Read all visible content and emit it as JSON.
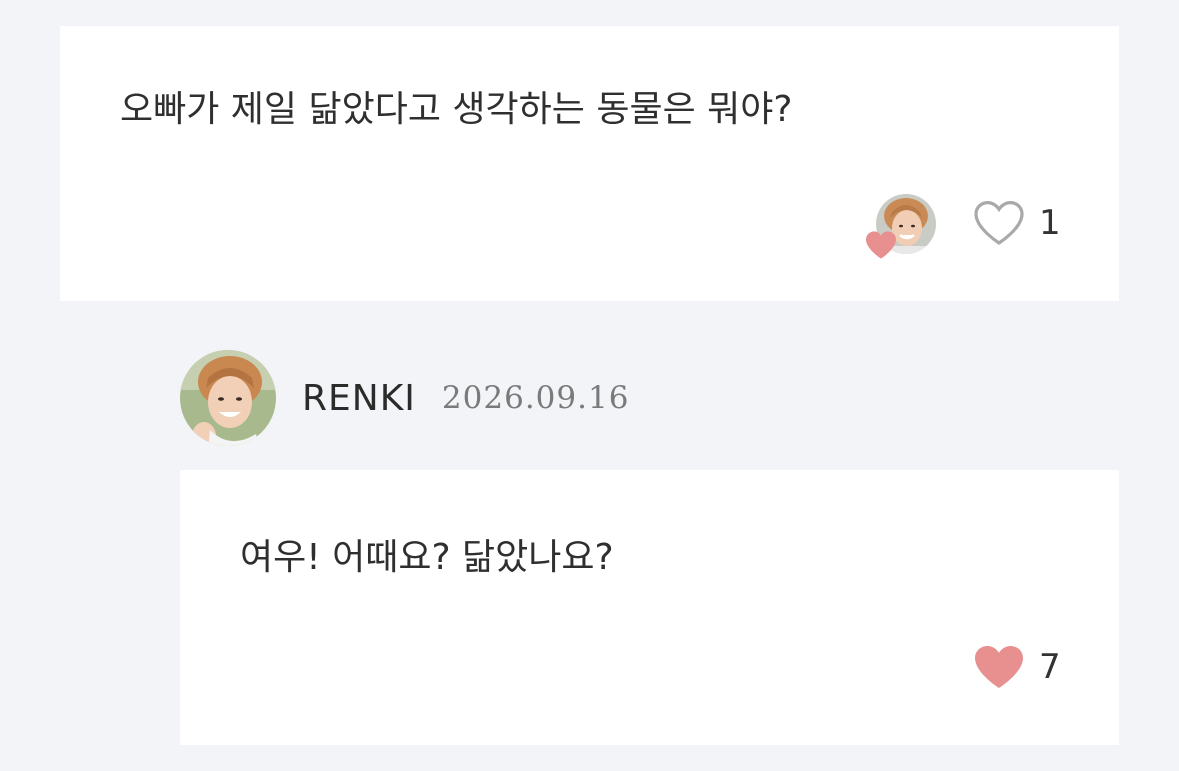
{
  "question": {
    "text": "오빠가 제일 닮았다고 생각하는 동물은 뭐야?",
    "liker_avatar_icon": "user-avatar-photo",
    "like_icon": "heart-outline-icon",
    "like_count": "1"
  },
  "answer": {
    "author_name": "RENKI",
    "date": "2026.09.16",
    "author_avatar_icon": "user-avatar-photo",
    "text": "여우! 어때요? 닮았나요?",
    "like_icon": "heart-filled-icon",
    "like_count": "7"
  },
  "colors": {
    "background": "#f3f4f8",
    "card": "#ffffff",
    "heart_pink": "#e89090",
    "heart_outline": "#a9a9a9"
  }
}
